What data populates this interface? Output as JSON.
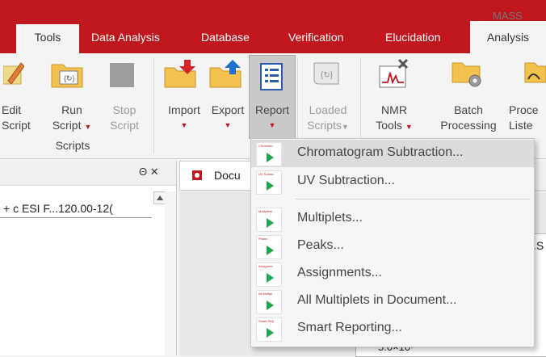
{
  "tabs": {
    "tools": "Tools",
    "data_analysis": "Data Analysis",
    "database": "Database",
    "verification": "Verification",
    "elucidation": "Elucidation",
    "analysis": "Analysis",
    "mass": "MASS"
  },
  "ribbon": {
    "edit_script": [
      "Edit",
      "Script"
    ],
    "run_script": [
      "Run",
      "Script"
    ],
    "stop_script": [
      "Stop",
      "Script"
    ],
    "scripts_group": "Scripts",
    "import": "Import",
    "export": "Export",
    "report": "Report",
    "loaded_scripts": [
      "Loaded",
      "Scripts"
    ],
    "nmr_tools": [
      "NMR",
      "Tools"
    ],
    "batch_processing": [
      "Batch",
      "Processing"
    ],
    "process_listener": [
      "Proce",
      "Liste"
    ]
  },
  "left_panel": {
    "dock_symbols": "Θ ✕",
    "item": "+ c ESI F...120.00-12("
  },
  "doc_panel": {
    "tab_label": "Docu",
    "right_value": ".S",
    "axis_value": "5.0×10⁷"
  },
  "menu": {
    "items": [
      {
        "label": "Chromatogram Subtraction...",
        "thumb": "Chromato"
      },
      {
        "label": "UV Subtraction...",
        "thumb": "UV Subtra"
      },
      {
        "label": "Multiplets...",
        "thumb": "Multiplets"
      },
      {
        "label": "Peaks...",
        "thumb": "Peaks"
      },
      {
        "label": "Assignments...",
        "thumb": "Assignme"
      },
      {
        "label": "All Multiplets in Document...",
        "thumb": "All Multipl"
      },
      {
        "label": "Smart Reporting...",
        "thumb": "Smart Rep"
      }
    ]
  },
  "colors": {
    "brand_red": "#c0161e",
    "play_green": "#1fa64a"
  }
}
